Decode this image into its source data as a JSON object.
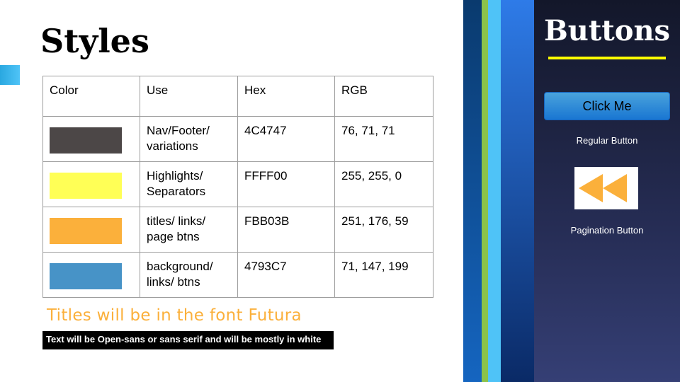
{
  "slide": {
    "title": "Styles"
  },
  "table": {
    "headers": [
      "Color",
      "Use",
      "Hex",
      "RGB"
    ],
    "rows": [
      {
        "swatch": "#4C4747",
        "use": "Nav/Footer/ variations",
        "hex": "4C4747",
        "rgb": "76, 71, 71"
      },
      {
        "swatch": "#FFFF56",
        "use": "Highlights/ Separators",
        "hex": "FFFF00",
        "rgb": "255, 255, 0"
      },
      {
        "swatch": "#FBB03B",
        "use": "titles/ links/ page btns",
        "hex": "FBB03B",
        "rgb": "251, 176, 59"
      },
      {
        "swatch": "#4793C7",
        "use": "background/ links/ btns",
        "hex": "4793C7",
        "rgb": "71, 147, 199"
      }
    ]
  },
  "notes": {
    "font_note": "Titles will be in the font Futura",
    "text_note": "Text will be Open-sans or sans serif and will be mostly in white"
  },
  "panel": {
    "title": "Buttons",
    "regular_button_label": "Click Me",
    "regular_caption": "Regular Button",
    "pagination_icon": "double-left-arrow-icon",
    "pagination_caption": "Pagination Button"
  },
  "colors": {
    "accent": "#FBB03B",
    "separator": "#FFFF00",
    "button": "#4793C7"
  }
}
